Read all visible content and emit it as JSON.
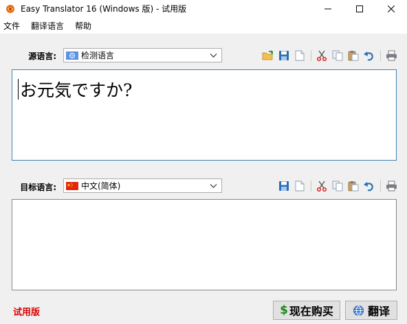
{
  "window": {
    "title": "Easy Translator 16 (Windows 版) - 试用版"
  },
  "menu": {
    "items": [
      "文件",
      "翻译语言",
      "帮助"
    ]
  },
  "source": {
    "label": "源语言:",
    "language": "检测语言",
    "text": "お元気ですか?"
  },
  "target": {
    "label": "目标语言:",
    "language": "中文(简体)",
    "text": ""
  },
  "footer": {
    "trial_label": "试用版",
    "buy_label": "现在购买",
    "buy_symbol": "$",
    "translate_label": "翻译"
  },
  "colors": {
    "trial": "#e00000",
    "focus_border": "#3c7fb1",
    "buy_symbol": "#1a8a1a"
  },
  "icons": [
    "open-folder-icon",
    "save-icon",
    "new-document-icon",
    "cut-icon",
    "copy-icon",
    "paste-icon",
    "undo-icon",
    "print-icon",
    "globe-icon"
  ]
}
